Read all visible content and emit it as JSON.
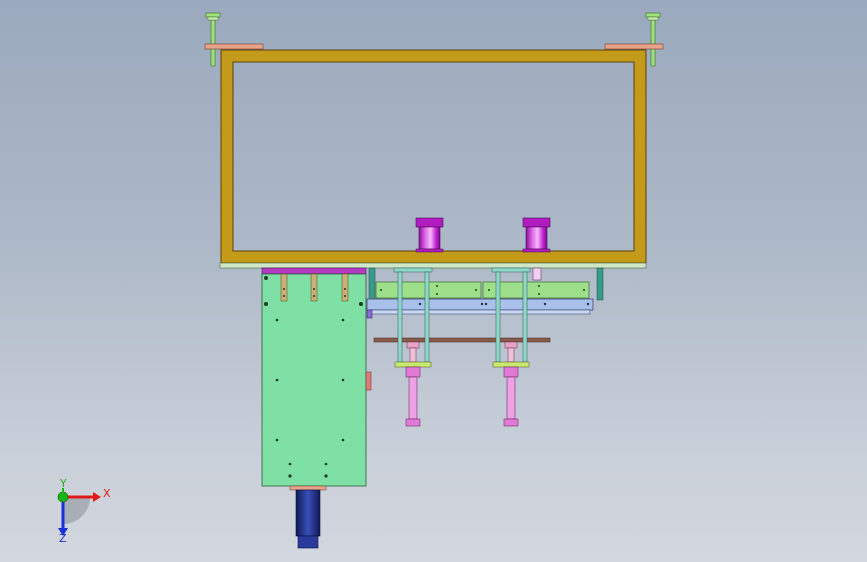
{
  "triad": {
    "x_label": "X",
    "y_label": "Y",
    "z_label": "Z",
    "x_color": "#e11b1b",
    "y_color": "#18b814",
    "z_color": "#1b2fd6"
  },
  "palette": {
    "frame": "#c49a1a",
    "plate_green": "#7fe0a6",
    "plate_green_light": "#9ee08a",
    "magenta": "#c71fd6",
    "pink": "#e07ad6",
    "teal_rod": "#8fd8c8",
    "blue_bar": "#a8c0ea",
    "brown_bar": "#8a5a4a",
    "salmon": "#e8a48a",
    "dark_blue": "#1f2f86"
  }
}
